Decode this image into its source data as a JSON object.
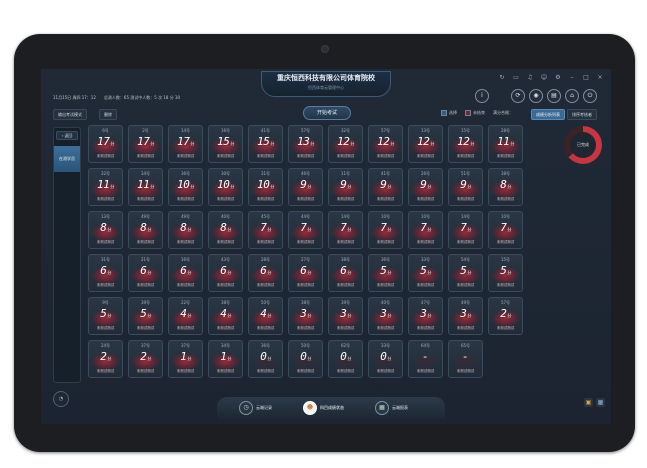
{
  "header": {
    "title": "重庆恒西科技有限公司体育院校",
    "subtitle": "恒西体育云管理中心",
    "info": "11月15日 周四 17：12　　总测人数：65  测试中人数：5  次  18  分  30"
  },
  "toolbar": {
    "export_label": "输出考试模式",
    "clear_label": "删除",
    "start_label": "开始考试",
    "legend_selected": "选择",
    "legend_ended": "未结束",
    "group_label": "满分合格：",
    "tab_scores": "成绩分析列表",
    "tab_ranking": "排序考核者"
  },
  "sidebar": {
    "back_label": "返回",
    "item_label": "在测学员"
  },
  "ring": {
    "label": "已完成"
  },
  "cells": [
    {
      "num": "6号",
      "value": "17",
      "unit": "分",
      "status": "未测试测试"
    },
    {
      "num": "2号",
      "value": "17",
      "unit": "分",
      "status": "未测试测试"
    },
    {
      "num": "14号",
      "value": "17",
      "unit": "分",
      "status": "未测试测试"
    },
    {
      "num": "16号",
      "value": "15",
      "unit": "分",
      "status": "未测试测试"
    },
    {
      "num": "41号",
      "value": "15",
      "unit": "分",
      "status": "未测试测试"
    },
    {
      "num": "57号",
      "value": "13",
      "unit": "分",
      "status": "未测试测试"
    },
    {
      "num": "32号",
      "value": "12",
      "unit": "分",
      "status": "未测试测试"
    },
    {
      "num": "57号",
      "value": "12",
      "unit": "分",
      "status": "未测试测试"
    },
    {
      "num": "13号",
      "value": "12",
      "unit": "分",
      "status": "未测试测试"
    },
    {
      "num": "15号",
      "value": "12",
      "unit": "分",
      "status": "未测试测试"
    },
    {
      "num": "28号",
      "value": "11",
      "unit": "分",
      "status": "未测试测试"
    },
    {
      "num": "32号",
      "value": "11",
      "unit": "分",
      "status": "未测试测试"
    },
    {
      "num": "34号",
      "value": "11",
      "unit": "分",
      "status": "未测试测试"
    },
    {
      "num": "36号",
      "value": "10",
      "unit": "分",
      "status": "未测试测试"
    },
    {
      "num": "30号",
      "value": "10",
      "unit": "分",
      "status": "未测试测试"
    },
    {
      "num": "31号",
      "value": "10",
      "unit": "分",
      "status": "未测试测试"
    },
    {
      "num": "46号",
      "value": "9",
      "unit": "分",
      "status": "未测试测试"
    },
    {
      "num": "11号",
      "value": "9",
      "unit": "分",
      "status": "未测试测试"
    },
    {
      "num": "41号",
      "value": "9",
      "unit": "分",
      "status": "未测试测试"
    },
    {
      "num": "26号",
      "value": "9",
      "unit": "分",
      "status": "未测试测试"
    },
    {
      "num": "51号",
      "value": "9",
      "unit": "分",
      "status": "未测试测试"
    },
    {
      "num": "38号",
      "value": "8",
      "unit": "分",
      "status": "未测试测试"
    },
    {
      "num": "13号",
      "value": "8",
      "unit": "分",
      "status": "未测试测试"
    },
    {
      "num": "49号",
      "value": "8",
      "unit": "分",
      "status": "未测试测试"
    },
    {
      "num": "49号",
      "value": "8",
      "unit": "分",
      "status": "未测试测试"
    },
    {
      "num": "40号",
      "value": "8",
      "unit": "分",
      "status": "未测试测试"
    },
    {
      "num": "45号",
      "value": "7",
      "unit": "分",
      "status": "未测试测试"
    },
    {
      "num": "44号",
      "value": "7",
      "unit": "分",
      "status": "未测试测试"
    },
    {
      "num": "14号",
      "value": "7",
      "unit": "分",
      "status": "未测试测试"
    },
    {
      "num": "10号",
      "value": "7",
      "unit": "分",
      "status": "未测试测试"
    },
    {
      "num": "10号",
      "value": "7",
      "unit": "分",
      "status": "未测试测试"
    },
    {
      "num": "14号",
      "value": "7",
      "unit": "分",
      "status": "未测试测试"
    },
    {
      "num": "10号",
      "value": "7",
      "unit": "分",
      "status": "未测试测试"
    },
    {
      "num": "31号",
      "value": "6",
      "unit": "分",
      "status": "未测试测试"
    },
    {
      "num": "21号",
      "value": "6",
      "unit": "分",
      "status": "未测试测试"
    },
    {
      "num": "16号",
      "value": "6",
      "unit": "分",
      "status": "未测试测试"
    },
    {
      "num": "43号",
      "value": "6",
      "unit": "分",
      "status": "未测试测试"
    },
    {
      "num": "28号",
      "value": "6",
      "unit": "分",
      "status": "未测试测试"
    },
    {
      "num": "27号",
      "value": "6",
      "unit": "分",
      "status": "未测试测试"
    },
    {
      "num": "38号",
      "value": "6",
      "unit": "分",
      "status": "未测试测试"
    },
    {
      "num": "36号",
      "value": "5",
      "unit": "分",
      "status": "未测试测试"
    },
    {
      "num": "33号",
      "value": "5",
      "unit": "分",
      "status": "未测试测试"
    },
    {
      "num": "54号",
      "value": "5",
      "unit": "分",
      "status": "未测试测试"
    },
    {
      "num": "15号",
      "value": "5",
      "unit": "分",
      "status": "未测试测试"
    },
    {
      "num": "9号",
      "value": "5",
      "unit": "分",
      "status": "未测试测试"
    },
    {
      "num": "39号",
      "value": "5",
      "unit": "分",
      "status": "未测试测试"
    },
    {
      "num": "22号",
      "value": "4",
      "unit": "分",
      "status": "未测试测试"
    },
    {
      "num": "38号",
      "value": "4",
      "unit": "分",
      "status": "未测试测试"
    },
    {
      "num": "50号",
      "value": "4",
      "unit": "分",
      "status": "未测试测试"
    },
    {
      "num": "38号",
      "value": "3",
      "unit": "分",
      "status": "未测试测试"
    },
    {
      "num": "39号",
      "value": "3",
      "unit": "分",
      "status": "未测试测试"
    },
    {
      "num": "40号",
      "value": "3",
      "unit": "分",
      "status": "未测试测试"
    },
    {
      "num": "47号",
      "value": "3",
      "unit": "分",
      "status": "未测试测试"
    },
    {
      "num": "49号",
      "value": "3",
      "unit": "分",
      "status": "未测试测试"
    },
    {
      "num": "57号",
      "value": "2",
      "unit": "分",
      "status": "未测试测试"
    },
    {
      "num": "24号",
      "value": "2",
      "unit": "分",
      "status": "未测试测试"
    },
    {
      "num": "37号",
      "value": "2",
      "unit": "分",
      "status": "未测试测试"
    },
    {
      "num": "37号",
      "value": "1",
      "unit": "分",
      "status": "未测试测试"
    },
    {
      "num": "34号",
      "value": "1",
      "unit": "分",
      "status": "未测试测试"
    },
    {
      "num": "36号",
      "value": "0",
      "unit": "分",
      "status": "未测试测试"
    },
    {
      "num": "50号",
      "value": "0",
      "unit": "分",
      "status": "未测试测试"
    },
    {
      "num": "62号",
      "value": "0",
      "unit": "分",
      "status": "未测试测试"
    },
    {
      "num": "33号",
      "value": "0",
      "unit": "分",
      "status": "未测试测试"
    },
    {
      "num": "64号",
      "value": "-",
      "unit": "",
      "status": "未测试测试"
    },
    {
      "num": "65号",
      "value": "-",
      "unit": "",
      "status": "未测试测试"
    }
  ],
  "bottom": {
    "item1": "云端记录",
    "item2": "科目成绩状态",
    "item3": "云端报表"
  },
  "icons": {
    "win": [
      "refresh-icon",
      "minimize-icon",
      "music-icon",
      "user-icon",
      "settings-icon",
      "window-icon",
      "maximize-icon",
      "close-icon"
    ],
    "circle": [
      "info-icon",
      "sync-icon",
      "camera-icon",
      "chart-icon",
      "home-icon",
      "power-icon"
    ]
  },
  "colors": {
    "accent": "#3a6a95",
    "alert": "#c8343f"
  }
}
